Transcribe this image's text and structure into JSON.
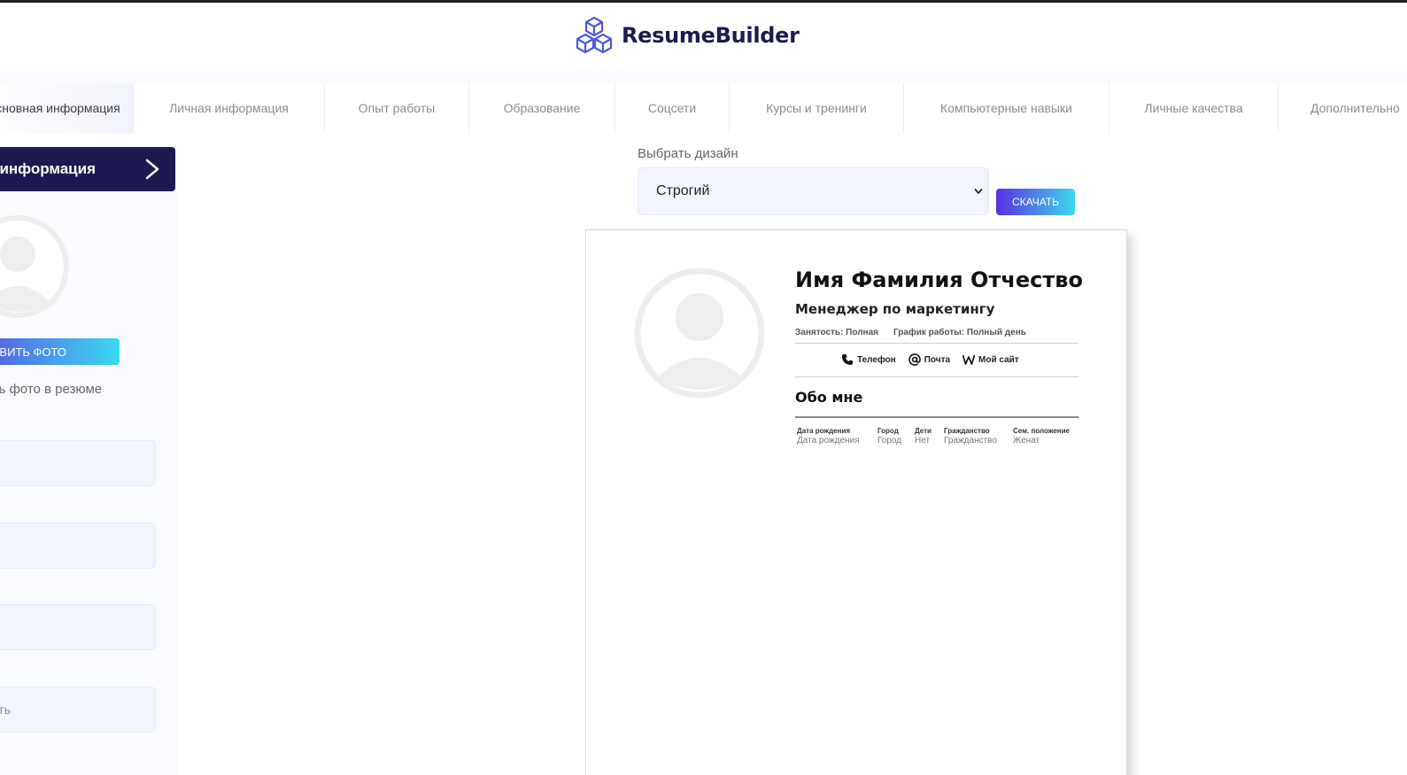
{
  "header": {
    "logo_text": "ResumeBuilder"
  },
  "tabs": [
    {
      "label": "Основная информация",
      "active": true
    },
    {
      "label": "Личная информация",
      "active": false
    },
    {
      "label": "Опыт работы",
      "active": false
    },
    {
      "label": "Образование",
      "active": false
    },
    {
      "label": "Соцсети",
      "active": false
    },
    {
      "label": "Курсы и тренинги",
      "active": false
    },
    {
      "label": "Компьютерные навыки",
      "active": false
    },
    {
      "label": "Личные качества",
      "active": false
    },
    {
      "label": "Дополнительно",
      "active": false
    }
  ],
  "sidebar": {
    "section_title": "Основная информация",
    "upload_button": "ДОБАВИТЬ ФОТО",
    "photo_checkbox_label": "Добавить фото в резюме",
    "fields": [
      {
        "placeholder": ""
      },
      {
        "placeholder": ""
      },
      {
        "placeholder": ""
      },
      {
        "placeholder": "Должность"
      }
    ]
  },
  "design": {
    "label": "Выбрать дизайн",
    "selected": "Строгий",
    "download_button": "СКАЧАТЬ"
  },
  "resume": {
    "name": "Имя Фамилия Отчество",
    "position": "Менеджер по маркетингу",
    "employment": "Занятость: Полная",
    "schedule": "График работы: Полный день",
    "contacts": {
      "phone": "Телефон",
      "email": "Почта",
      "site": "Мой сайт"
    },
    "about_title": "Обо мне",
    "info": [
      {
        "header": "Дата рождения",
        "value": "Дата рождения"
      },
      {
        "header": "Город",
        "value": "Город"
      },
      {
        "header": "Дети",
        "value": "Нет"
      },
      {
        "header": "Гражданство",
        "value": "Гражданство"
      },
      {
        "header": "Сем. положение",
        "value": "Женат"
      }
    ]
  },
  "colors": {
    "brand_dark": "#1c1a4f",
    "accent_gradient_start": "#5b4ae6",
    "accent_gradient_end": "#3ad9f0",
    "field_bg": "#f2f5ff"
  }
}
